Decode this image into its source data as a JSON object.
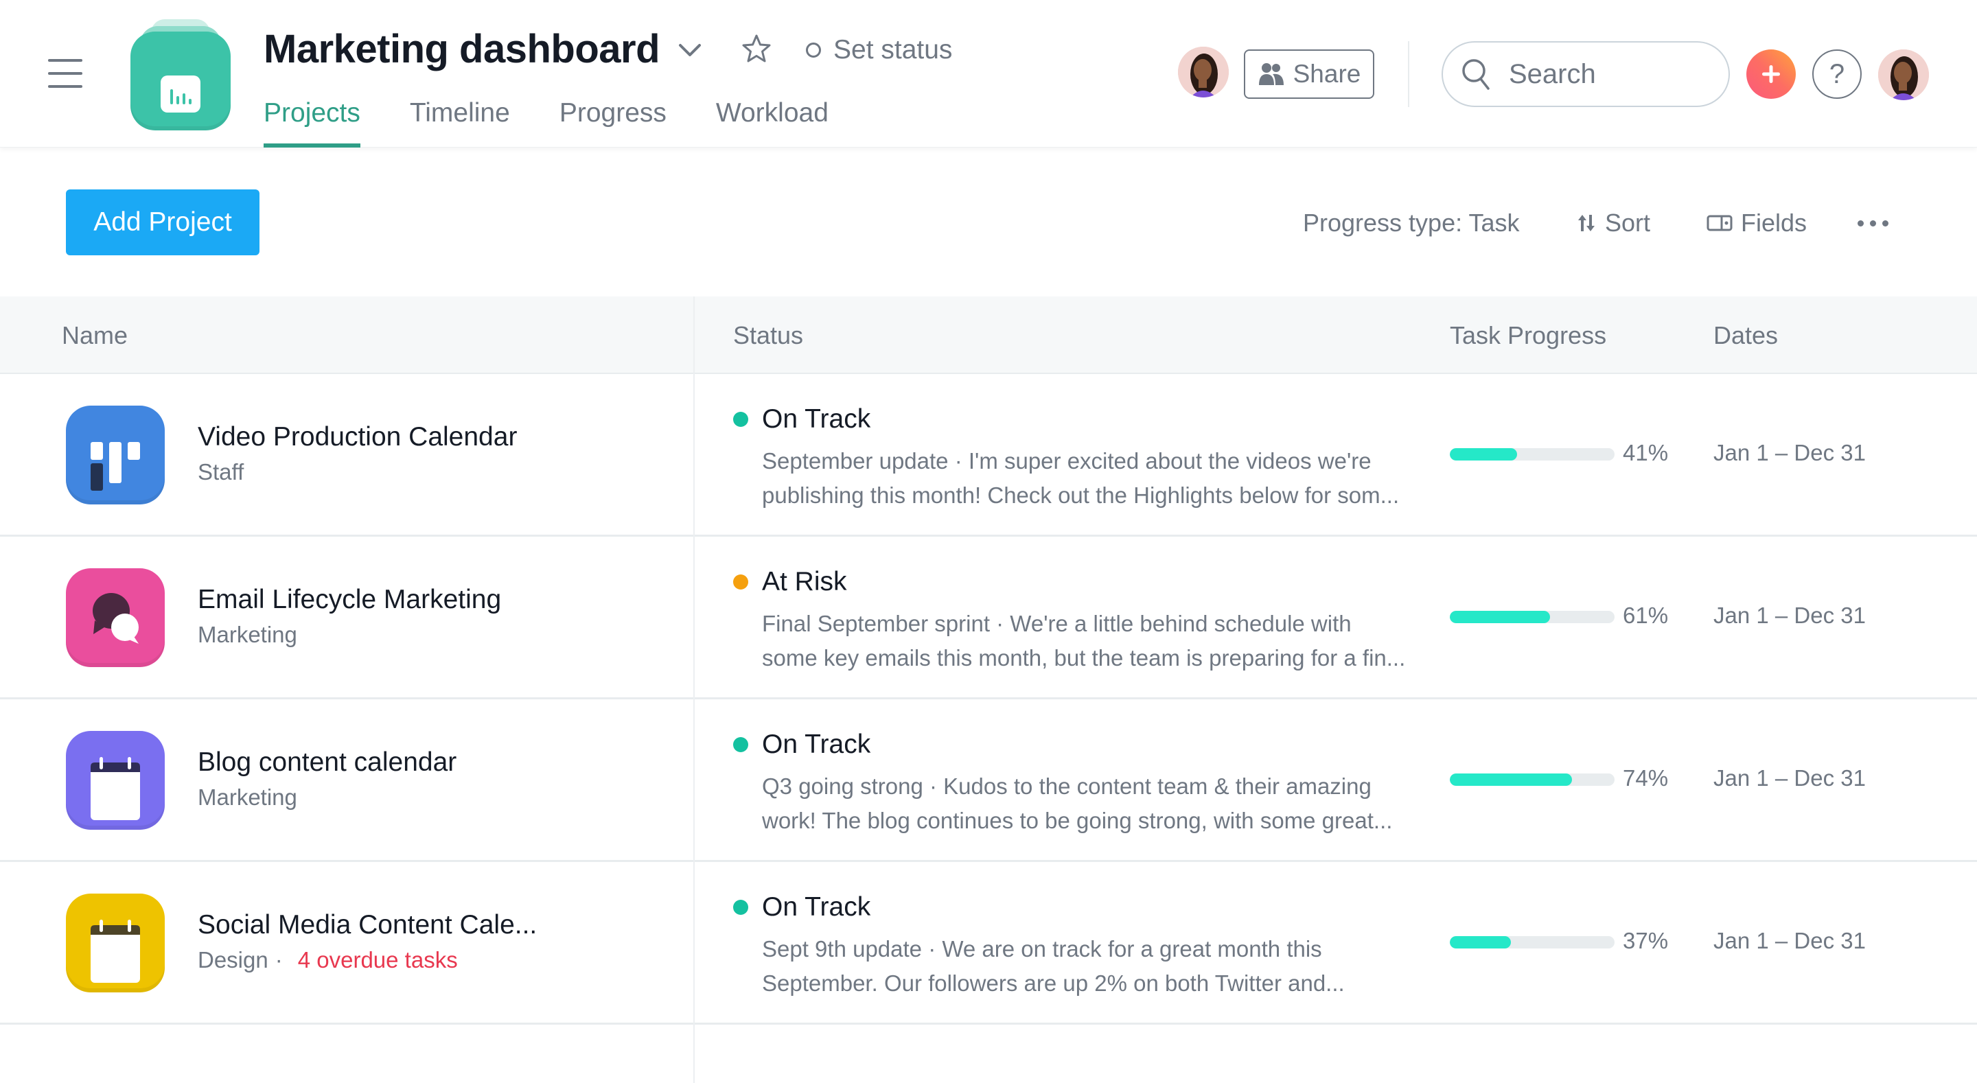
{
  "header": {
    "title": "Marketing dashboard",
    "set_status_label": "Set status",
    "tabs": [
      {
        "label": "Projects",
        "active": true
      },
      {
        "label": "Timeline",
        "active": false
      },
      {
        "label": "Progress",
        "active": false
      },
      {
        "label": "Workload",
        "active": false
      }
    ],
    "share_label": "Share",
    "search_placeholder": "Search",
    "help_label": "?",
    "accent_color": "#3cc3a8"
  },
  "toolbar": {
    "add_project_label": "Add Project",
    "progress_type_label": "Progress type: Task",
    "sort_label": "Sort",
    "fields_label": "Fields"
  },
  "table": {
    "columns": [
      "Name",
      "Status",
      "Task Progress",
      "Dates"
    ],
    "rows": [
      {
        "name": "Video Production Calendar",
        "team": "Staff",
        "overdue": "",
        "icon": "board-icon",
        "icon_color": "#4186e0",
        "status": "On Track",
        "status_color": "#14c1a0",
        "update_line1": "September update · I'm super excited about the videos we're",
        "update_line2": "publishing this month! Check out the Highlights below for som...",
        "progress": 41,
        "progress_label": "41%",
        "dates": "Jan 1 – Dec 31"
      },
      {
        "name": "Email Lifecycle Marketing",
        "team": "Marketing",
        "overdue": "",
        "icon": "chat-bubbles-icon",
        "icon_color": "#ea4e9d",
        "status": "At Risk",
        "status_color": "#f5a00f",
        "update_line1": "Final September sprint · We're a little behind schedule with",
        "update_line2": "some key emails this month, but the team is preparing for a fin...",
        "progress": 61,
        "progress_label": "61%",
        "dates": "Jan 1 – Dec 31"
      },
      {
        "name": "Blog content calendar",
        "team": "Marketing",
        "overdue": "",
        "icon": "calendar-icon",
        "icon_color": "#7a6ff0",
        "status": "On Track",
        "status_color": "#14c1a0",
        "update_line1": "Q3 going strong · Kudos to the content team & their amazing",
        "update_line2": "work! The blog continues to be going strong, with some great...",
        "progress": 74,
        "progress_label": "74%",
        "dates": "Jan 1 – Dec 31"
      },
      {
        "name": "Social Media Content Cale...",
        "team": "Design",
        "team_separator": "·",
        "overdue": "4 overdue tasks",
        "icon": "calendar-icon",
        "icon_color": "#eec300",
        "status": "On Track",
        "status_color": "#14c1a0",
        "update_line1": "Sept 9th update · We are on track for a great month this",
        "update_line2": "September. Our followers are up 2% on both Twitter and...",
        "progress": 37,
        "progress_label": "37%",
        "dates": "Jan 1 – Dec 31"
      }
    ]
  }
}
